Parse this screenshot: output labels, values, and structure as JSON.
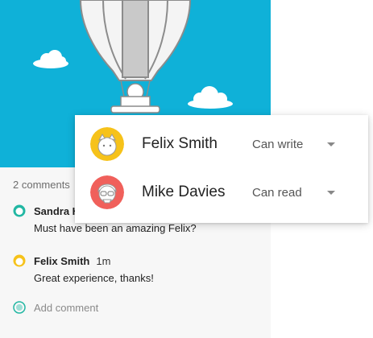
{
  "comments_section": {
    "count_label": "2 comments",
    "items": [
      {
        "author": "Sandra H",
        "time": "",
        "text": "Must have been an amazing Felix?"
      },
      {
        "author": "Felix Smith",
        "time": "1m",
        "text": "Great experience, thanks!"
      }
    ],
    "add_placeholder": "Add comment"
  },
  "share_popup": {
    "people": [
      {
        "name": "Felix Smith",
        "permission": "Can write",
        "avatar_color": "#f6c21a"
      },
      {
        "name": "Mike Davies",
        "permission": "Can read",
        "avatar_color": "#f0605b"
      }
    ]
  },
  "colors": {
    "hero": "#0fb1d8",
    "accent_teal": "#22b7a3",
    "accent_yellow": "#f6c21a"
  }
}
